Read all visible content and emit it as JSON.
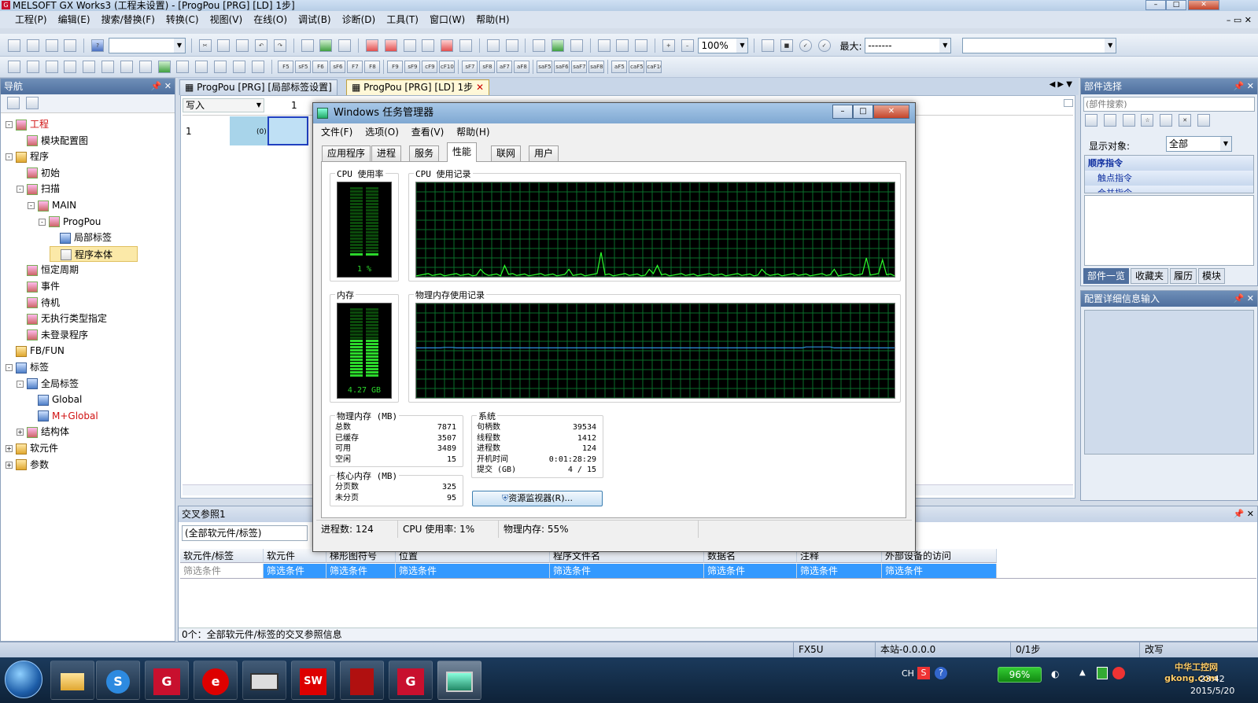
{
  "window": {
    "title": "MELSOFT GX Works3 (工程未设置) - [ProgPou [PRG] [LD] 1步]",
    "app_icon": "G"
  },
  "menu": [
    "工程(P)",
    "编辑(E)",
    "搜索/替换(F)",
    "转换(C)",
    "视图(V)",
    "在线(O)",
    "调试(B)",
    "诊断(D)",
    "工具(T)",
    "窗口(W)",
    "帮助(H)"
  ],
  "toolbar": {
    "zoom": "100%",
    "max_label": "最大:",
    "max_value": "-------",
    "fkeys": [
      "F5",
      "sF5",
      "F6",
      "sF6",
      "F7",
      "F8",
      "F9",
      "sF9",
      "cF9",
      "cF10",
      "sF7",
      "sF8",
      "aF7",
      "aF8",
      "saF5",
      "saF6",
      "saF7",
      "saF8",
      "aF5",
      "caF5",
      "caF10"
    ]
  },
  "nav": {
    "title": "导航",
    "items": [
      {
        "label": "工程",
        "level": 0,
        "exp": "-",
        "red": true
      },
      {
        "label": "模块配置图",
        "level": 1,
        "exp": ""
      },
      {
        "label": "程序",
        "level": 0,
        "exp": "-"
      },
      {
        "label": "初始",
        "level": 1,
        "exp": ""
      },
      {
        "label": "扫描",
        "level": 1,
        "exp": "-"
      },
      {
        "label": "MAIN",
        "level": 2,
        "exp": "-"
      },
      {
        "label": "ProgPou",
        "level": 3,
        "exp": "-"
      },
      {
        "label": "局部标签",
        "level": 4,
        "exp": ""
      },
      {
        "label": "程序本体",
        "level": 4,
        "exp": "",
        "selected": true
      },
      {
        "label": "恒定周期",
        "level": 1,
        "exp": ""
      },
      {
        "label": "事件",
        "level": 1,
        "exp": ""
      },
      {
        "label": "待机",
        "level": 1,
        "exp": ""
      },
      {
        "label": "无执行类型指定",
        "level": 1,
        "exp": ""
      },
      {
        "label": "未登录程序",
        "level": 1,
        "exp": ""
      },
      {
        "label": "FB/FUN",
        "level": 0,
        "exp": ""
      },
      {
        "label": "标签",
        "level": 0,
        "exp": "-"
      },
      {
        "label": "全局标签",
        "level": 1,
        "exp": "-"
      },
      {
        "label": "Global",
        "level": 2,
        "exp": ""
      },
      {
        "label": "M+Global",
        "level": 2,
        "exp": "",
        "red": true
      },
      {
        "label": "结构体",
        "level": 1,
        "exp": "+"
      },
      {
        "label": "软元件",
        "level": 0,
        "exp": "+"
      },
      {
        "label": "参数",
        "level": 0,
        "exp": "+"
      }
    ]
  },
  "editor_tabs": [
    {
      "label": "ProgPou [PRG] [局部标签设置]",
      "active": false
    },
    {
      "label": "ProgPou [PRG] [LD] 1步",
      "active": true
    }
  ],
  "editor": {
    "mode": "写入",
    "col1": "1",
    "row1": "1",
    "step0": "(0)"
  },
  "parts": {
    "title": "部件选择",
    "search_placeholder": "(部件搜索)",
    "display_label": "显示对象:",
    "display_value": "全部",
    "items": [
      "顺序指令",
      "触点指令",
      "合并指令"
    ],
    "tabs": [
      "部件一览",
      "收藏夹",
      "履历",
      "模块"
    ]
  },
  "config": {
    "title": "配置详细信息输入"
  },
  "xref": {
    "title": "交叉参照1",
    "filter": "(全部软元件/标签)",
    "columns": [
      "软元件/标签",
      "软元件",
      "梯形图符号",
      "位置",
      "程序文件名",
      "数据名",
      "注释",
      "外部设备的访问"
    ],
    "filter_row": [
      "筛选条件",
      "筛选条件",
      "筛选条件",
      "筛选条件",
      "筛选条件",
      "筛选条件",
      "筛选条件",
      "筛选条件"
    ],
    "status": "0个：全部软元件/标签的交叉参照信息"
  },
  "statusbar": {
    "cpu": "FX5U",
    "station": "本站-0.0.0.0",
    "steps": "0/1步",
    "mode": "改写"
  },
  "taskmgr": {
    "title": "Windows 任务管理器",
    "menu": [
      "文件(F)",
      "选项(O)",
      "查看(V)",
      "帮助(H)"
    ],
    "tabs": [
      "应用程序",
      "进程",
      "服务",
      "性能",
      "联网",
      "用户"
    ],
    "active_tab": 3,
    "cpu_usage_label": "CPU 使用率",
    "cpu_usage_value": "1 %",
    "cpu_usage_fraction": 0.01,
    "cpu_history_label": "CPU 使用记录",
    "mem_label": "内存",
    "mem_value": "4.27 GB",
    "mem_fraction": 0.55,
    "mem_history_label": "物理内存使用记录",
    "phys_mem": {
      "title": "物理内存 (MB)",
      "rows": [
        [
          "总数",
          "7871"
        ],
        [
          "已缓存",
          "3507"
        ],
        [
          "可用",
          "3489"
        ],
        [
          "空闲",
          "15"
        ]
      ]
    },
    "kernel_mem": {
      "title": "核心内存 (MB)",
      "rows": [
        [
          "分页数",
          "325"
        ],
        [
          "未分页",
          "95"
        ]
      ]
    },
    "system": {
      "title": "系统",
      "rows": [
        [
          "句柄数",
          "39534"
        ],
        [
          "线程数",
          "1412"
        ],
        [
          "进程数",
          "124"
        ],
        [
          "开机时间",
          "0:01:28:29"
        ],
        [
          "提交 (GB)",
          "4 / 15"
        ]
      ]
    },
    "resmon_button": "资源监视器(R)...",
    "status": {
      "processes": "进程数: 124",
      "cpu": "CPU 使用率: 1%",
      "mem": "物理内存: 55%"
    }
  },
  "taskbar": {
    "apps": [
      "folder",
      "sogou",
      "GX",
      "e",
      "keyboard",
      "SW",
      "acrobat",
      "GX2",
      "taskmgr"
    ],
    "tray_lang": "CH",
    "battery": "96%",
    "time": "23:42",
    "date": "2015/5/20",
    "watermark": "中华工控网 gkong.com"
  },
  "colors": {
    "graph_grid": "#0a6e2a",
    "cpu_line": "#2cff2c",
    "mem_line": "#2f8fe0",
    "meter_on": "#2bd82b",
    "meter_off": "#0b4a0b"
  }
}
